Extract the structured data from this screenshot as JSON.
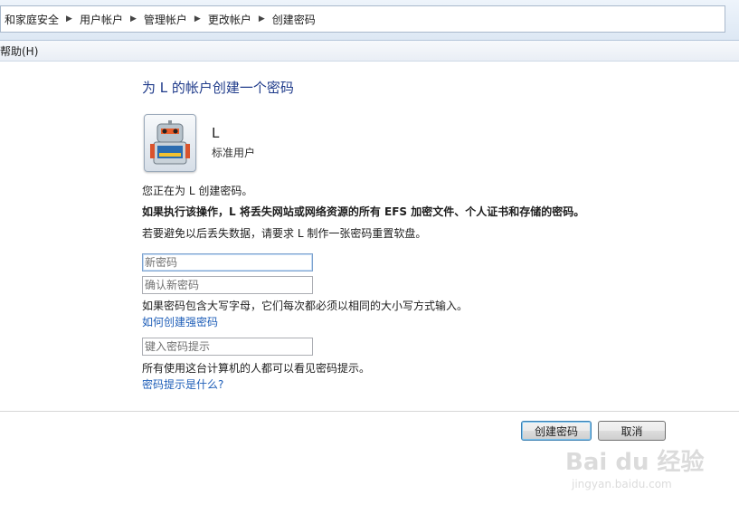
{
  "breadcrumb": {
    "items": [
      "和家庭安全",
      "用户帐户",
      "管理帐户",
      "更改帐户",
      "创建密码"
    ]
  },
  "menu": {
    "help": "帮助(H)"
  },
  "page": {
    "title": "为 L 的帐户创建一个密码",
    "user": {
      "name": "L",
      "type": "标准用户",
      "avatar_icon": "robot-avatar-icon"
    },
    "intro": "您正在为 L 创建密码。",
    "warning": "如果执行该操作，L 将丢失网站或网络资源的所有 EFS 加密文件、个人证书和存储的密码。",
    "advice": "若要避免以后丢失数据，请要求 L 制作一张密码重置软盘。"
  },
  "form": {
    "new_password": {
      "placeholder": "新密码",
      "value": ""
    },
    "confirm_password": {
      "placeholder": "确认新密码",
      "value": ""
    },
    "case_note": "如果密码包含大写字母，它们每次都必须以相同的大小写方式输入。",
    "strong_link": "如何创建强密码",
    "hint": {
      "placeholder": "键入密码提示",
      "value": ""
    },
    "hint_note": "所有使用这台计算机的人都可以看见密码提示。",
    "hint_link": "密码提示是什么?"
  },
  "buttons": {
    "create": "创建密码",
    "cancel": "取消"
  },
  "watermark": {
    "main": "Bai du 经验",
    "sub": "jingyan.baidu.com"
  },
  "colors": {
    "title": "#1e3a8a",
    "link": "#1e5eb8",
    "primary_button_border": "#3c7fb1"
  }
}
